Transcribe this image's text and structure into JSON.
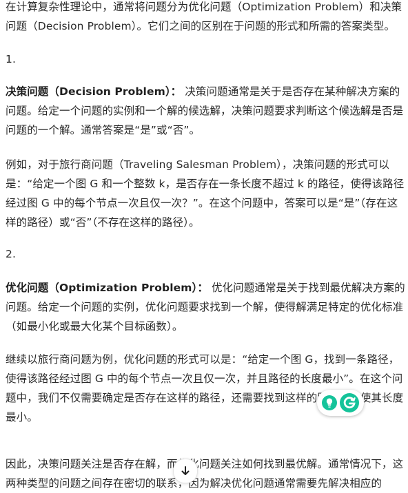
{
  "intro": "在计算复杂性理论中，通常将问题分为优化问题（Optimization Problem）和决策问题（Decision Problem）。它们之间的区别在于问题的形式和所需的答案类型。",
  "item1": {
    "number": "1.",
    "term": "决策问题（Decision Problem）：",
    "definition": "决策问题通常是关于是否存在某种解决方案的问题。给定一个问题的实例和一个解的候选解，决策问题要求判断这个候选解是否是问题的一个解。通常答案是“是”或“否”。",
    "example": "例如，对于旅行商问题（Traveling Salesman Problem），决策问题的形式可以是：“给定一个图 G 和一个整数 k，是否存在一条长度不超过 k 的路径，使得该路径经过图 G 中的每个节点一次且仅一次？”。在这个问题中，答案可以是“是”（存在这样的路径）或“否”（不存在这样的路径）。"
  },
  "item2": {
    "number": "2.",
    "term": "优化问题（Optimization Problem）：",
    "definition": "优化问题通常是关于找到最优解决方案的问题。给定一个问题的实例，优化问题要求找到一个解，使得解满足特定的优化标准（如最小化或最大化某个目标函数）。",
    "example": "继续以旅行商问题为例，优化问题的形式可以是：“给定一个图 G，找到一条路径，使得该路径经过图 G 中的每个节点一次且仅一次，并且路径的长度最小”。在这个问题中，我们不仅需要确定是否存在这样的路径，还需要找到这样的路径，并使其长度最小。"
  },
  "conclusion": "因此，决策问题关注是否存在解，而优化问题关注如何找到最优解。通常情况下，这两种类型的问题之间存在密切的联系，因为解决优化问题通常需要先解决相应的",
  "widgets": {
    "grammarly_icon": "grammarly-g-icon",
    "bulb_icon": "lightbulb-icon",
    "scroll_icon": "arrow-down-icon",
    "grammarly_color": "#15c39a"
  }
}
